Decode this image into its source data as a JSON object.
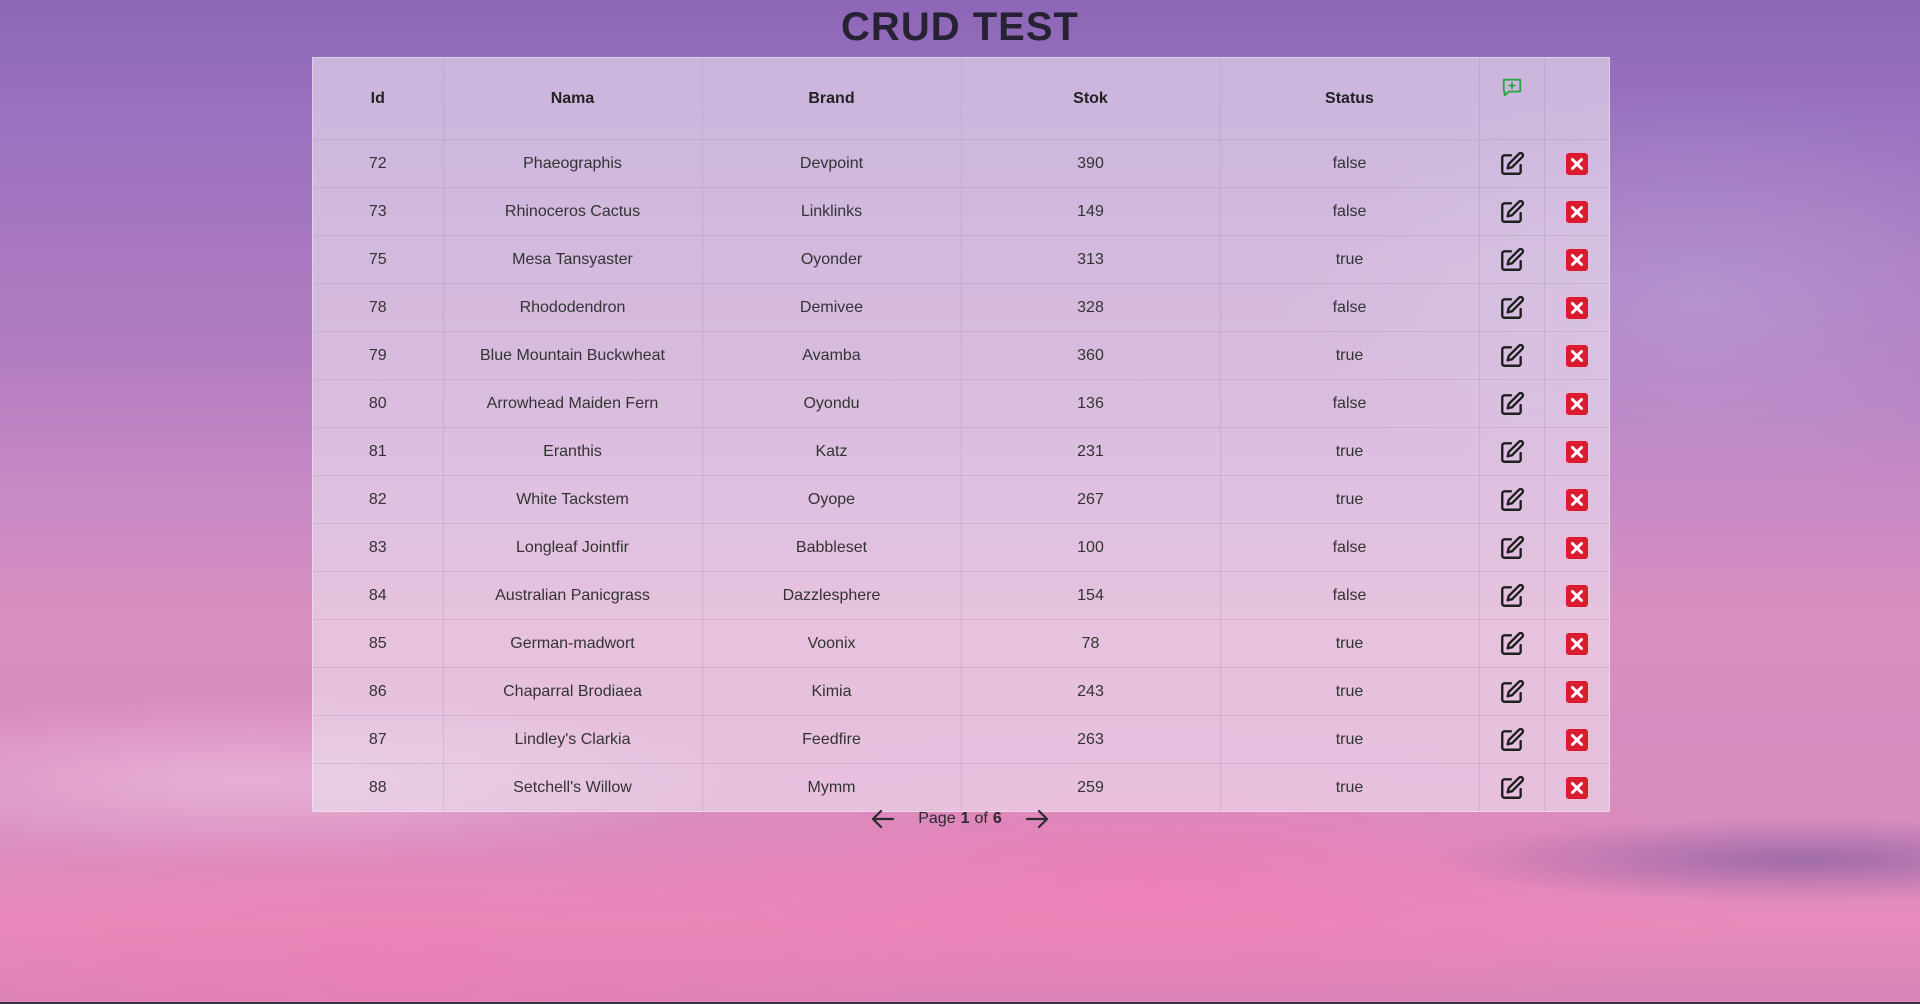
{
  "title": "CRUD TEST",
  "table": {
    "headers": [
      "Id",
      "Nama",
      "Brand",
      "Stok",
      "Status"
    ],
    "rows": [
      {
        "id": "72",
        "nama": "Phaeographis",
        "brand": "Devpoint",
        "stok": "390",
        "status": "false"
      },
      {
        "id": "73",
        "nama": "Rhinoceros Cactus",
        "brand": "Linklinks",
        "stok": "149",
        "status": "false"
      },
      {
        "id": "75",
        "nama": "Mesa Tansyaster",
        "brand": "Oyonder",
        "stok": "313",
        "status": "true"
      },
      {
        "id": "78",
        "nama": "Rhododendron",
        "brand": "Demivee",
        "stok": "328",
        "status": "false"
      },
      {
        "id": "79",
        "nama": "Blue Mountain Buckwheat",
        "brand": "Avamba",
        "stok": "360",
        "status": "true"
      },
      {
        "id": "80",
        "nama": "Arrowhead Maiden Fern",
        "brand": "Oyondu",
        "stok": "136",
        "status": "false"
      },
      {
        "id": "81",
        "nama": "Eranthis",
        "brand": "Katz",
        "stok": "231",
        "status": "true"
      },
      {
        "id": "82",
        "nama": "White Tackstem",
        "brand": "Oyope",
        "stok": "267",
        "status": "true"
      },
      {
        "id": "83",
        "nama": "Longleaf Jointfir",
        "brand": "Babbleset",
        "stok": "100",
        "status": "false"
      },
      {
        "id": "84",
        "nama": "Australian Panicgrass",
        "brand": "Dazzlesphere",
        "stok": "154",
        "status": "false"
      },
      {
        "id": "85",
        "nama": "German-madwort",
        "brand": "Voonix",
        "stok": "78",
        "status": "true"
      },
      {
        "id": "86",
        "nama": "Chaparral Brodiaea",
        "brand": "Kimia",
        "stok": "243",
        "status": "true"
      },
      {
        "id": "87",
        "nama": "Lindley's Clarkia",
        "brand": "Feedfire",
        "stok": "263",
        "status": "true"
      },
      {
        "id": "88",
        "nama": "Setchell's Willow",
        "brand": "Mymm",
        "stok": "259",
        "status": "true"
      }
    ]
  },
  "icons": {
    "add": "comment-plus-icon",
    "edit": "edit-icon",
    "delete": "close-square-icon",
    "prev": "arrow-left-icon",
    "next": "arrow-right-icon"
  },
  "colors": {
    "add_icon": "#28a745",
    "delete_icon": "#dc1c2e",
    "edit_icon": "#1f1f1f"
  },
  "pagination": {
    "page_label": "Page",
    "current": "1",
    "of_label": "of",
    "total": "6"
  }
}
